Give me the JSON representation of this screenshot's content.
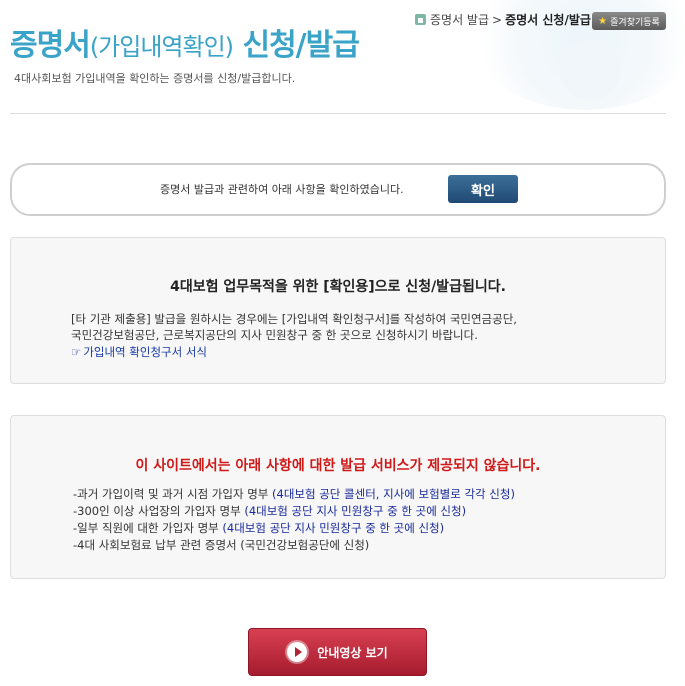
{
  "header": {
    "title_main": "증명서",
    "title_paren": "(가입내역확인)",
    "title_end": " 신청/발급",
    "subtitle": "4대사회보험 가입내역을 확인하는 증명서를 신청/발급합니다."
  },
  "breadcrumb": {
    "home_icon": "home-icon",
    "item1": "증명서 발급",
    "separator": ">",
    "current": "증명서 신청/발급"
  },
  "favorites": {
    "icon": "star-icon",
    "label": "즐겨찾기등록"
  },
  "confirm": {
    "text": "증명서 발급과 관련하여 아래 사항을 확인하였습니다.",
    "button_label": "확인"
  },
  "info": {
    "heading": "4대보험 업무목적을 위한 [확인용]으로 신청/발급됩니다.",
    "line1": "[타 기관 제출용] 발급을 원하시는 경우에는 [가입내역 확인청구서]를 작성하여 국민연금공단,",
    "line2": "국민건강보험공단, 근로복지공단의 지사 민원창구 중 한 곳으로 신청하시기 바랍니다.",
    "link_icon": "document-icon",
    "link_label": "가입내역 확인청구서 서식"
  },
  "warning": {
    "heading": "이 사이트에서는 아래 사항에 대한 발급 서비스가 제공되지 않습니다.",
    "items": [
      {
        "text": "-과거 가입이력 및 과거 시점 가입자 명부 ",
        "note": "(4대보험 공단 콜센터, 지사에 보험별로 각각 신청)"
      },
      {
        "text": "-300인 이상 사업장의 가입자 명부 ",
        "note": "(4대보험 공단 지사 민원창구 중 한 곳에 신청)"
      },
      {
        "text": "-일부 직원에 대한 가입자 명부 ",
        "note": "(4대보험 공단 지사 민원창구 중 한 곳에 신청)"
      },
      {
        "text": "-4대 사회보험료 납부 관련 증명서 (국민건강보험공단에 신청)",
        "note": ""
      }
    ]
  },
  "video_button": {
    "icon": "play-icon",
    "label": "안내영상 보기"
  },
  "colors": {
    "title": "#3aa3c8",
    "warning": "#d01818",
    "link": "#1a3ba8",
    "confirm_button": "#2a5682",
    "video_button": "#c02c3f"
  }
}
